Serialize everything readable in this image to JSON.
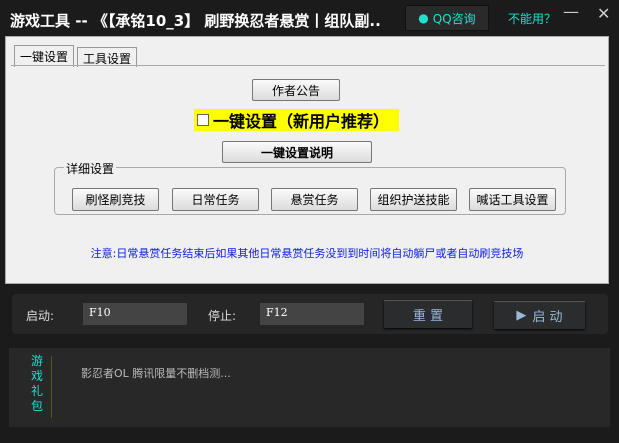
{
  "window": {
    "title": "游戏工具 -- 《【承铭10_3】 刷野换忍者悬赏丨组队副..",
    "qq_button": "QQ咨询",
    "cant_use": "不能用？",
    "minimize": "—",
    "close": "✕"
  },
  "tabs": [
    {
      "label": "一键设置",
      "active": true
    },
    {
      "label": "工具设置",
      "active": false
    }
  ],
  "main": {
    "author_notice": "作者公告",
    "onekey_checkbox": "一键设置（新用户推荐）",
    "onekey_checked": false,
    "onekey_help": "一键设置说明",
    "group_label": "详细设置",
    "buttons": [
      "刷怪刷竞技",
      "日常任务",
      "悬赏任务",
      "组织护送技能",
      "喊话工具设置"
    ],
    "note": "注意:日常悬赏任务结束后如果其他日常悬赏任务没到到时间将自动躺尸或者自动刷竞技场"
  },
  "hotkeys": {
    "start_label": "启动:",
    "start_value": "F10",
    "stop_label": "停止:",
    "stop_value": "F12",
    "reset_button": "重 置",
    "start_button": "启 动"
  },
  "gift": {
    "label": "游戏礼包",
    "text": "影忍者OL 腾讯限量不删档测..."
  }
}
